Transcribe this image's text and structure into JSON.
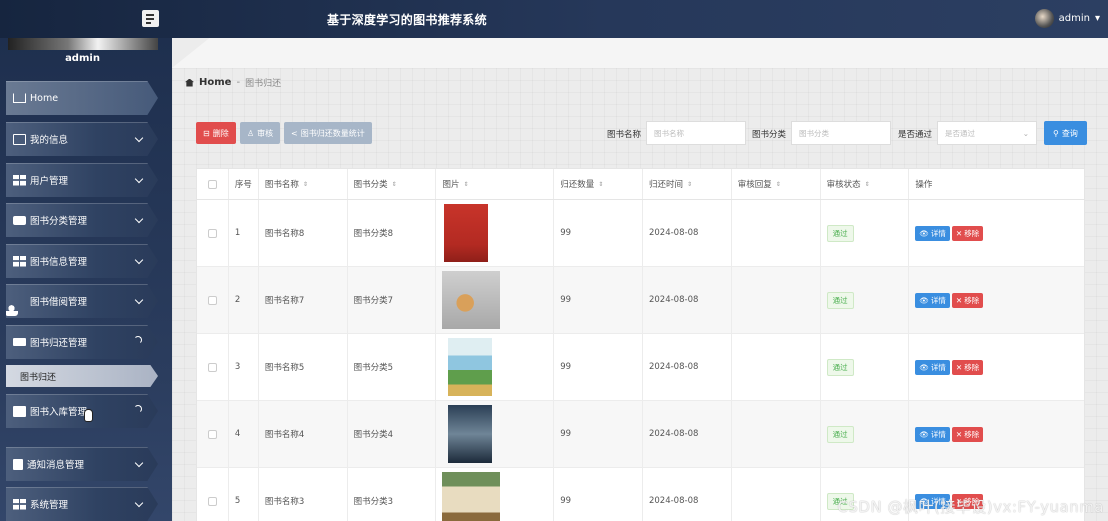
{
  "header": {
    "title": "基于深度学习的图书推荐系统",
    "username": "admin"
  },
  "sidebar": {
    "admin_name": "admin",
    "items": [
      {
        "label": "Home",
        "icon": "home-icon"
      },
      {
        "label": "我的信息",
        "icon": "profile-icon"
      },
      {
        "label": "用户管理",
        "icon": "grid-icon"
      },
      {
        "label": "图书分类管理",
        "icon": "briefcase-icon"
      },
      {
        "label": "图书信息管理",
        "icon": "grid-icon"
      },
      {
        "label": "图书借阅管理",
        "icon": "user-icon"
      },
      {
        "label": "图书归还管理",
        "icon": "monitor-icon"
      },
      {
        "label": "图书入库管理",
        "icon": "chart-icon"
      },
      {
        "label": "通知消息管理",
        "icon": "document-icon"
      },
      {
        "label": "系统管理",
        "icon": "grid-icon"
      }
    ],
    "sub_item": "图书归还"
  },
  "breadcrumb": {
    "home": "Home",
    "sep": "-",
    "current": "图书归还"
  },
  "toolbar": {
    "delete": "删除",
    "audit": "审核",
    "stats": "图书归还数量统计",
    "search": "查询"
  },
  "filters": [
    {
      "label": "图书名称",
      "placeholder": "图书名称"
    },
    {
      "label": "图书分类",
      "placeholder": "图书分类"
    },
    {
      "label": "是否通过",
      "placeholder": "是否通过"
    }
  ],
  "table": {
    "headers": [
      "序号",
      "图书名称",
      "图书分类",
      "图片",
      "归还数量",
      "归还时间",
      "审核回复",
      "审核状态",
      "操作"
    ],
    "rows": [
      {
        "no": "1",
        "name": "图书名称8",
        "category": "图书分类8",
        "qty": "99",
        "date": "2024-08-08",
        "reply": "",
        "status": "通过"
      },
      {
        "no": "2",
        "name": "图书名称7",
        "category": "图书分类7",
        "qty": "99",
        "date": "2024-08-08",
        "reply": "",
        "status": "通过"
      },
      {
        "no": "3",
        "name": "图书名称5",
        "category": "图书分类5",
        "qty": "99",
        "date": "2024-08-08",
        "reply": "",
        "status": "通过"
      },
      {
        "no": "4",
        "name": "图书名称4",
        "category": "图书分类4",
        "qty": "99",
        "date": "2024-08-08",
        "reply": "",
        "status": "通过"
      },
      {
        "no": "5",
        "name": "图书名称3",
        "category": "图书分类3",
        "qty": "99",
        "date": "2024-08-08",
        "reply": "",
        "status": "通过"
      }
    ],
    "actions": {
      "detail": "详情",
      "remove": "移除"
    }
  },
  "watermark": "CSDN @枫叶(接毕设)vx:FY-yuanma"
}
